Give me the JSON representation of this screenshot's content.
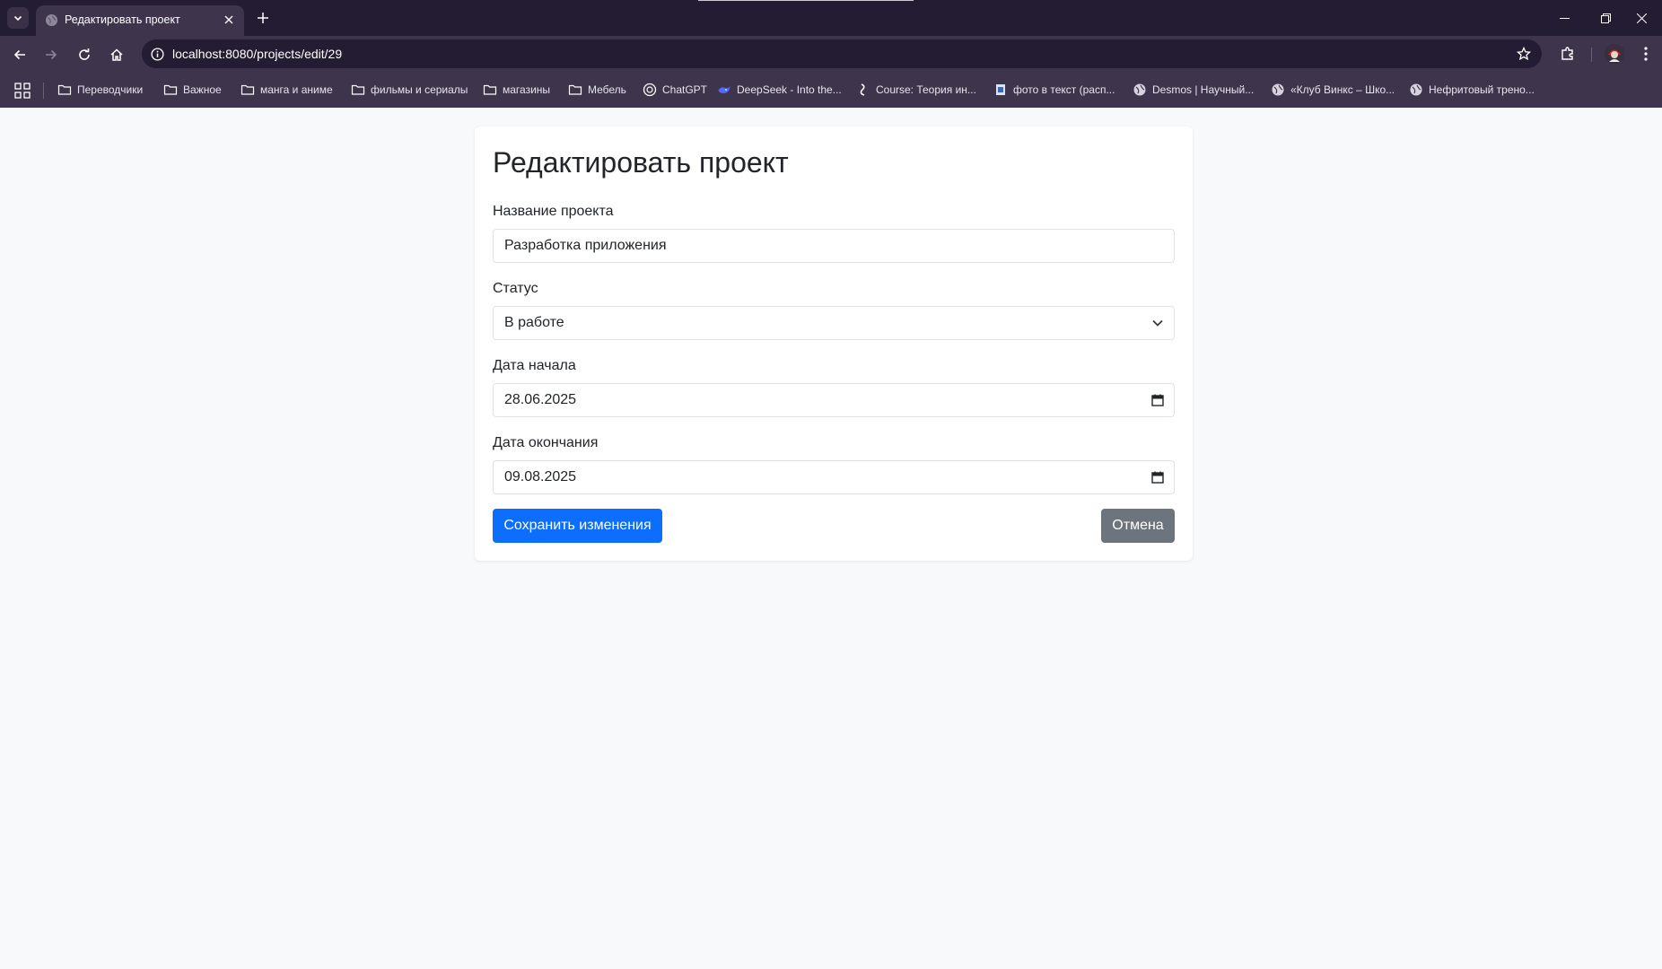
{
  "browser": {
    "tab_title": "Редактировать проект",
    "url": "localhost:8080/projects/edit/29",
    "bookmarks": [
      {
        "label": "Переводчики",
        "icon": "folder-icon"
      },
      {
        "label": "Важное",
        "icon": "folder-icon"
      },
      {
        "label": "манга и аниме",
        "icon": "folder-icon"
      },
      {
        "label": "фильмы и сериалы",
        "icon": "folder-icon"
      },
      {
        "label": "магазины",
        "icon": "folder-icon"
      },
      {
        "label": "Мебель",
        "icon": "folder-icon"
      },
      {
        "label": "ChatGPT",
        "icon": "chatgpt-icon"
      },
      {
        "label": "DeepSeek - Into the...",
        "icon": "deepseek-icon"
      },
      {
        "label": "Course: Теория ин...",
        "icon": "course-icon"
      },
      {
        "label": "фото в текст (расп...",
        "icon": "scan-icon"
      },
      {
        "label": "Desmos | Научный...",
        "icon": "globe-icon"
      },
      {
        "label": "«Клуб Винкс – Шко...",
        "icon": "globe-icon"
      },
      {
        "label": "Нефритовый трено...",
        "icon": "globe-icon"
      }
    ]
  },
  "form": {
    "title": "Редактировать проект",
    "name_label": "Название проекта",
    "name_value": "Разработка приложения",
    "status_label": "Статус",
    "status_value": "В работе",
    "start_label": "Дата начала",
    "start_value": "28.06.2025",
    "end_label": "Дата окончания",
    "end_value": "09.08.2025",
    "save_label": "Сохранить изменения",
    "cancel_label": "Отмена"
  },
  "colors": {
    "primary": "#0d6efd",
    "secondary": "#6c757d",
    "page_bg": "#f8f9fa",
    "chrome_dark": "#241c32",
    "chrome": "#3e354c"
  }
}
